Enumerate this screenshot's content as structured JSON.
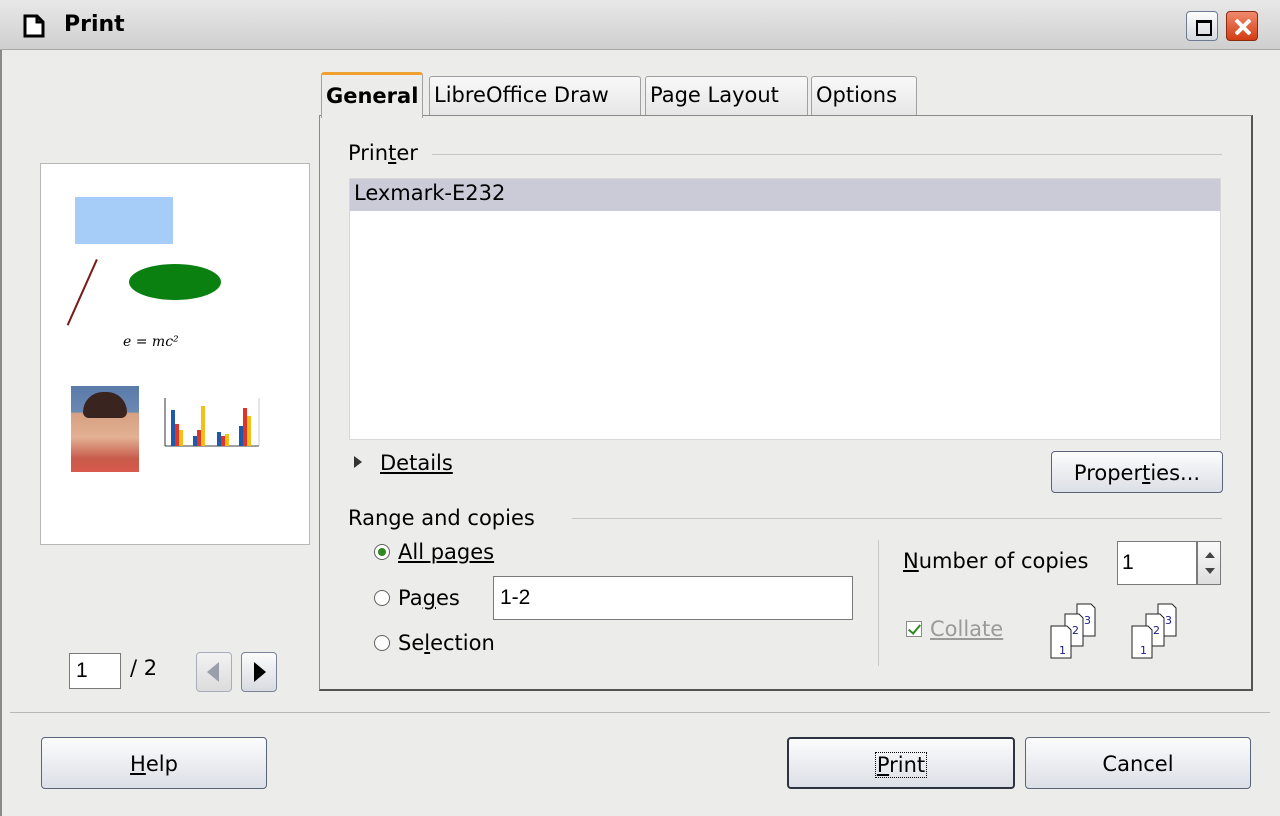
{
  "window": {
    "title": "Print",
    "app_icon": "document-icon",
    "controls": [
      "maximize-icon",
      "close-icon"
    ]
  },
  "preview": {
    "formula": "e = mc²",
    "page_current": "1",
    "page_total": "/ 2"
  },
  "tabs": [
    {
      "label": "General",
      "active": true
    },
    {
      "label": "LibreOffice Draw",
      "active": false
    },
    {
      "label": "Page Layout",
      "active": false
    },
    {
      "label": "Options",
      "active": false
    }
  ],
  "printer": {
    "section_label_pre": "Prin",
    "section_label_mnemonic": "t",
    "section_label_post": "er",
    "printers": [
      "Lexmark-E232"
    ],
    "selected": "Lexmark-E232",
    "details_label": "Details",
    "properties_pre": "Proper",
    "properties_mnemonic": "t",
    "properties_post": "ies..."
  },
  "range": {
    "section_label": "Range and copies",
    "all_pages": "All pages",
    "pages_pre": "Pa",
    "pages_mnemonic": "g",
    "pages_post": "es",
    "pages_value": "1-2",
    "selection_pre": "Se",
    "selection_mnemonic": "l",
    "selection_post": "ection",
    "selected_option": "all_pages"
  },
  "copies": {
    "label_mnemonic": "N",
    "label_post": "umber of copies",
    "value": "1",
    "collate_label": "Collate",
    "collate_checked": true
  },
  "buttons": {
    "help_mnemonic": "H",
    "help_post": "elp",
    "print_mnemonic": "P",
    "print_post": "rint",
    "cancel": "Cancel"
  },
  "colors": {
    "accent_tab": "#f0a030",
    "selected_row": "#cbcbd8",
    "close_button": "#d23c14"
  }
}
